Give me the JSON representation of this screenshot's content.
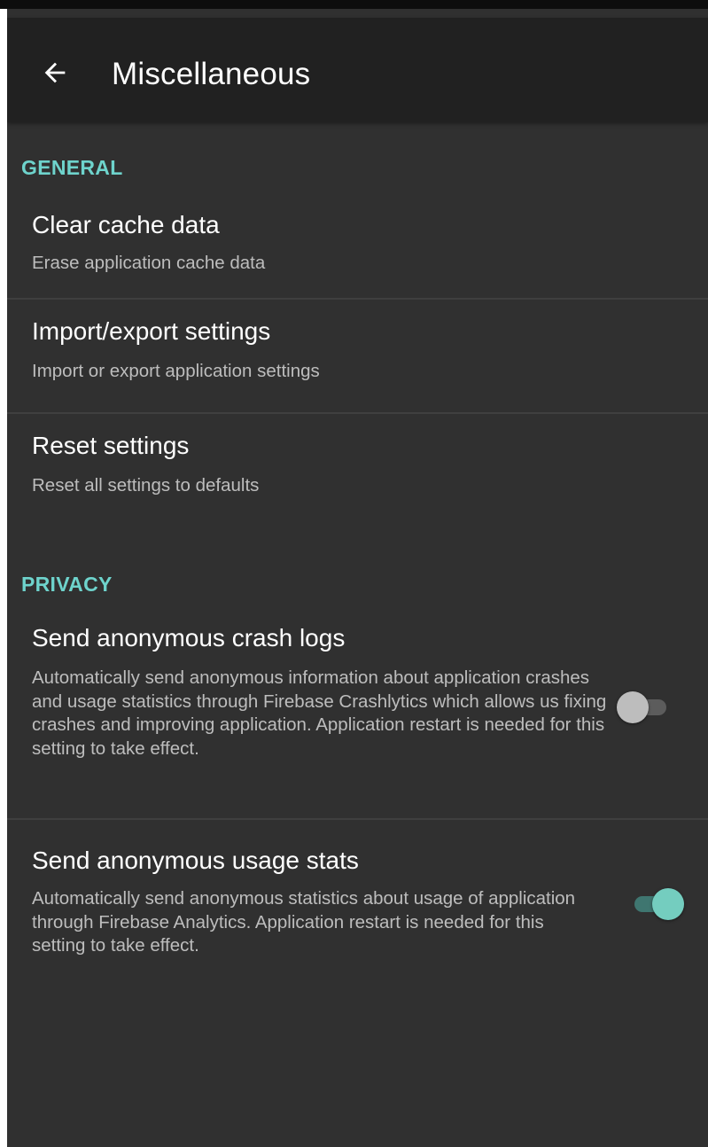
{
  "app_bar": {
    "title": "Miscellaneous",
    "back_icon": "arrow-back-icon"
  },
  "colors": {
    "accent": "#6ed3cc",
    "background": "#303030",
    "app_bar": "#212121",
    "switch_on_thumb": "#74cdbf",
    "switch_off_thumb": "#bdbdbd"
  },
  "sections": {
    "general": {
      "header": "GENERAL",
      "items": [
        {
          "title": "Clear cache data",
          "summary": "Erase application cache data"
        },
        {
          "title": "Import/export settings",
          "summary": "Import or export application settings"
        },
        {
          "title": "Reset settings",
          "summary": "Reset all settings to defaults"
        }
      ]
    },
    "privacy": {
      "header": "PRIVACY",
      "items": [
        {
          "title": "Send anonymous crash logs",
          "summary": "Automatically send anonymous information about application crashes and usage statistics through Firebase Crashlytics which allows us fixing crashes and improving application. Application restart is needed for this setting to take effect.",
          "enabled": false
        },
        {
          "title": "Send anonymous usage stats",
          "summary": "Automatically send anonymous statistics about usage of application through Firebase Analytics. Application restart is needed for this setting to take effect.",
          "enabled": true
        }
      ]
    }
  }
}
